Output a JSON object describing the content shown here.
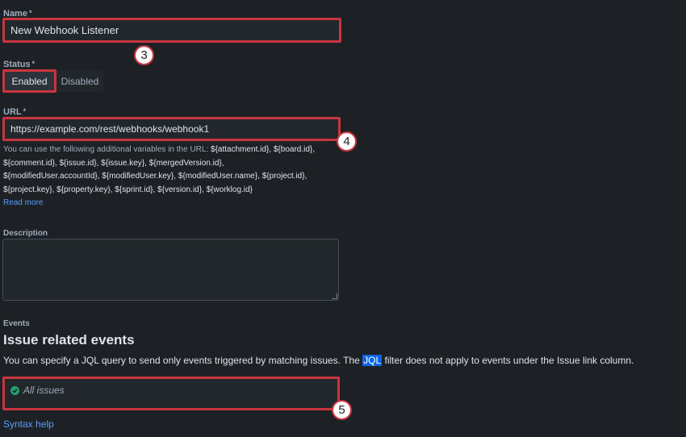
{
  "name_field": {
    "label": "Name",
    "required_mark": "*",
    "value": "New Webhook Listener",
    "callout": "3"
  },
  "status_field": {
    "label": "Status",
    "required_mark": "*",
    "options": [
      "Enabled",
      "Disabled"
    ],
    "selected": "Enabled"
  },
  "url_field": {
    "label": "URL",
    "required_mark": "*",
    "value": "https://example.com/rest/webhooks/webhook1",
    "callout": "4",
    "help_intro": "You can use the following additional variables in the URL:",
    "variables_line1": "${attachment.id}, ${board.id},",
    "variables_line2": "${comment.id}, ${issue.id}, ${issue.key}, ${mergedVersion.id},",
    "variables_line3": "${modifiedUser.accountId}, ${modifiedUser.key}, ${modifiedUser.name}, ${project.id},",
    "variables_line4": "${project.key}, ${property.key}, ${sprint.id}, ${version.id}, ${worklog.id}",
    "read_more": "Read more"
  },
  "description_field": {
    "label": "Description",
    "value": ""
  },
  "events": {
    "label": "Events",
    "heading": "Issue related events",
    "text_before": "You can specify a JQL query to send only events triggered by matching issues. The ",
    "jql_word": "JQL",
    "text_after": " filter does not apply to events under the Issue link column.",
    "jql_value": "All issues",
    "callout": "5",
    "syntax_help": "Syntax help"
  },
  "colors": {
    "background": "#1d2125",
    "highlight_border": "#c9353f",
    "link": "#579dff",
    "valid_check": "#22a06b"
  }
}
